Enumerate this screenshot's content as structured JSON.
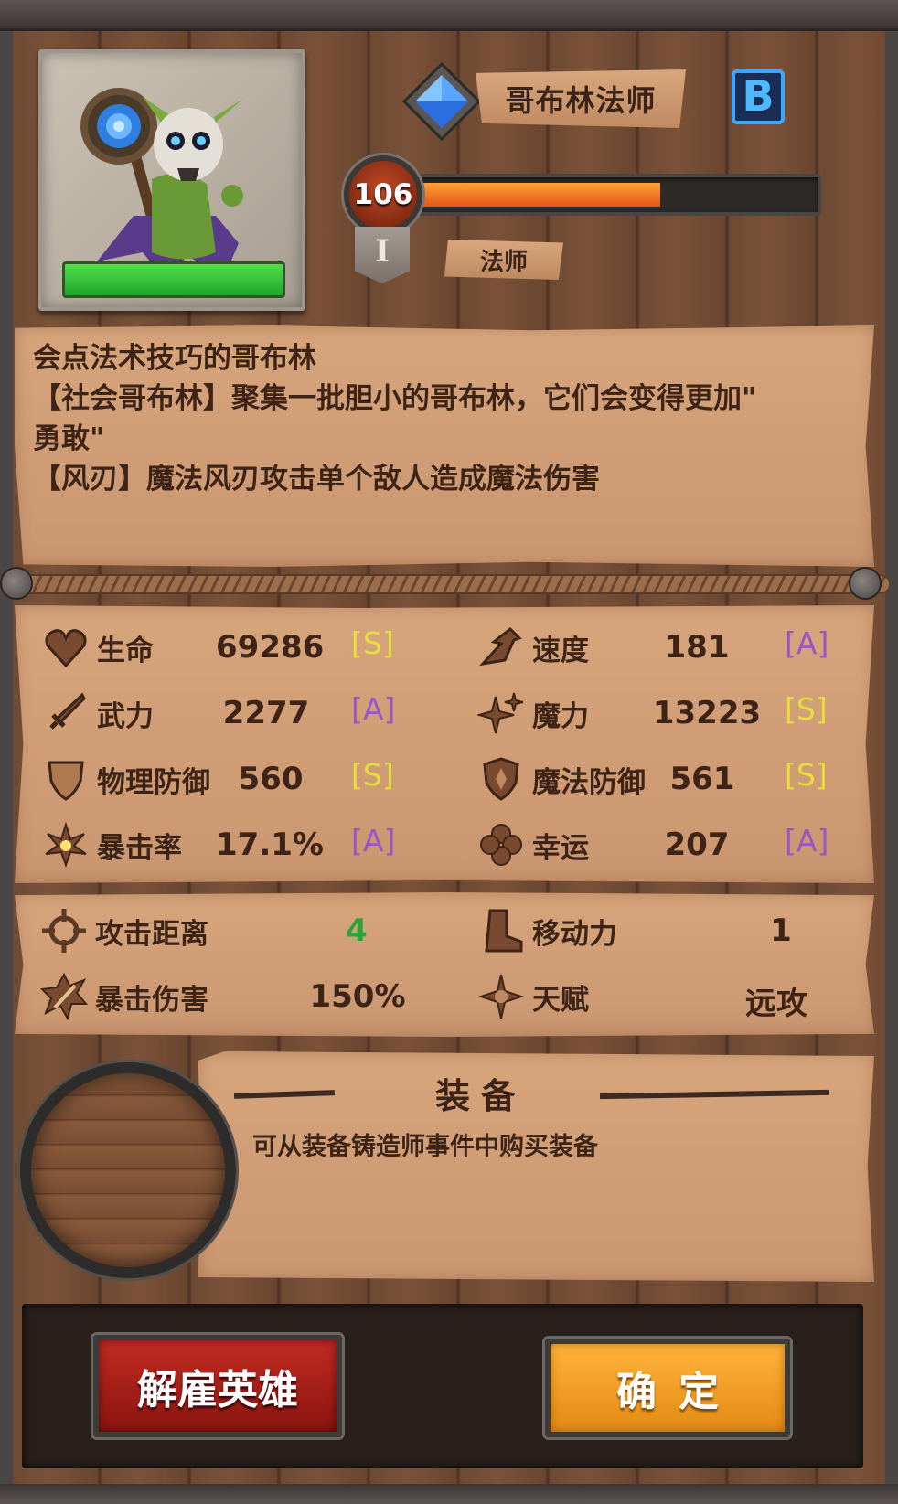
{
  "hero": {
    "name": "哥布林法师",
    "rank": "B",
    "level": "106",
    "xp_fraction": 0.61,
    "tier": "I",
    "class": "法师"
  },
  "description": {
    "lines": [
      "会点法术技巧的哥布林",
      "【社会哥布林】聚集一批胆小的哥布林，它们会变得更加\"",
      "勇敢\"",
      "【风刃】魔法风刃攻击单个敌人造成魔法伤害"
    ]
  },
  "stats": [
    {
      "label": "生命",
      "value": "69286",
      "grade": "[S]",
      "icon": "heart-icon"
    },
    {
      "label": "速度",
      "value": "181",
      "grade": "[A]",
      "icon": "speed-icon"
    },
    {
      "label": "武力",
      "value": "2277",
      "grade": "[A]",
      "icon": "sword-icon"
    },
    {
      "label": "魔力",
      "value": "13223",
      "grade": "[S]",
      "icon": "sparkle-icon"
    },
    {
      "label": "物理防御",
      "value": "560",
      "grade": "[S]",
      "icon": "shield-icon"
    },
    {
      "label": "魔法防御",
      "value": "561",
      "grade": "[S]",
      "icon": "magic-shield-icon"
    },
    {
      "label": "暴击率",
      "value": "17.1%",
      "grade": "[A]",
      "icon": "burst-icon"
    },
    {
      "label": "幸运",
      "value": "207",
      "grade": "[A]",
      "icon": "clover-icon"
    }
  ],
  "attributes": [
    {
      "label": "攻击距离",
      "value": "4",
      "icon": "crosshair-icon"
    },
    {
      "label": "移动力",
      "value": "1",
      "icon": "boot-icon"
    },
    {
      "label": "暴击伤害",
      "value": "150%",
      "icon": "crit-damage-icon"
    },
    {
      "label": "天赋",
      "value": "远攻",
      "icon": "talent-icon"
    }
  ],
  "equipment": {
    "title": "装备",
    "hint": "可从装备铸造师事件中购买装备"
  },
  "buttons": {
    "dismiss": "解雇英雄",
    "confirm": "确定"
  },
  "colors": {
    "grade_s": "#e6de3a",
    "grade_a": "#9a56c4",
    "range_value": "#2fa236",
    "xp_fill": "#f07020",
    "dismiss_button": "#b0201a",
    "confirm_button": "#f5a020",
    "rank_badge": "#3fa6ff"
  }
}
